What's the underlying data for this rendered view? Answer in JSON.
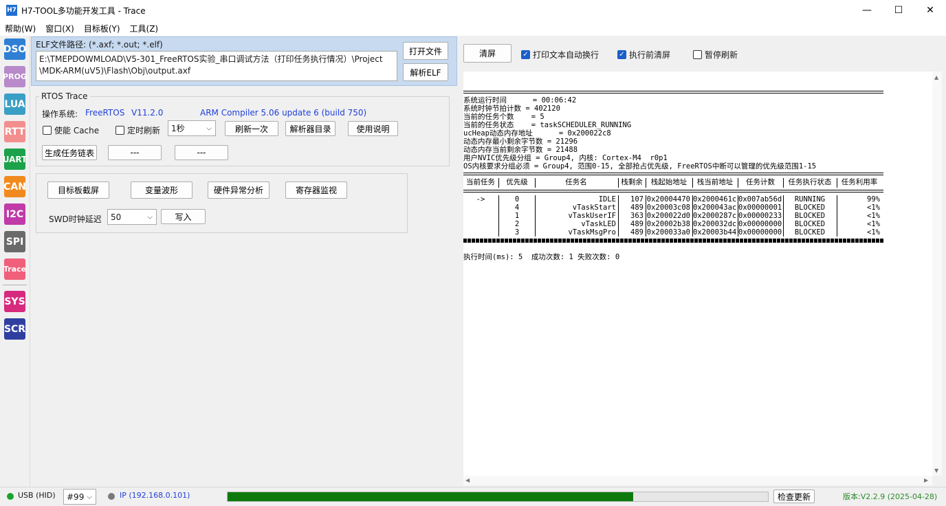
{
  "window": {
    "icon_text": "H7",
    "title": "H7-TOOL多功能开发工具 - Trace",
    "minimize": "—",
    "maximize": "☐",
    "close": "✕"
  },
  "menu": [
    "帮助(W)",
    "窗口(X)",
    "目标板(Y)",
    "工具(Z)"
  ],
  "sidebar": [
    {
      "label": "DSO",
      "color": "#2f7fd4"
    },
    {
      "label": "PROG",
      "color": "#b88ac9"
    },
    {
      "label": "LUA",
      "color": "#3a9fc5"
    },
    {
      "label": "RTT",
      "color": "#f28e8e"
    },
    {
      "label": "UART",
      "color": "#1ba24a"
    },
    {
      "label": "CAN",
      "color": "#f08a1e"
    },
    {
      "label": "I2C",
      "color": "#c03aa8"
    },
    {
      "label": "SPI",
      "color": "#6a6a6a"
    },
    {
      "label": "Trace",
      "color": "#f0607a"
    },
    {
      "label": "SYS",
      "color": "#d62a7e"
    },
    {
      "label": "SCR",
      "color": "#2f3fa0"
    }
  ],
  "elf": {
    "label": "ELF文件路径:  (*.axf; *.out; *.elf)",
    "path_line1": "E:\\TMEPDOWMLOAD\\V5-301_FreeRTOS实验_串口调试方法（打印任务执行情况）\\Project",
    "path_line2": "\\MDK-ARM(uV5)\\Flash\\Obj\\output.axf",
    "open_button": "打开文件",
    "parse_button": "解析ELF"
  },
  "rtos": {
    "group_title": "RTOS Trace",
    "os_label": "操作系统:",
    "os_name": "FreeRTOS",
    "os_version": "V11.2.0",
    "compiler": "ARM Compiler 5.06 update 6 (build 750)",
    "enable_cache": "使能 Cache",
    "timed_refresh": "定时刷新",
    "interval": "1秒",
    "refresh_once": "刷新一次",
    "parser_dir": "解析器目录",
    "usage": "使用说明",
    "gen_task_list": "生成任务链表",
    "btn_blank1": "---",
    "btn_blank2": "---"
  },
  "tools": {
    "screenshot": "目标板截屏",
    "var_wave": "变量波形",
    "hard_fault": "硬件异常分析",
    "reg_monitor": "寄存器监视",
    "swd_label": "SWD时钟延迟",
    "swd_value": "50",
    "write": "写入"
  },
  "right": {
    "clear": "清屏",
    "auto_wrap": "打印文本自动换行",
    "clear_before": "执行前清屏",
    "pause_refresh": "暂停刷新"
  },
  "console": {
    "info": [
      "系统运行时间      = 00:06:42",
      "系统时钟节拍计数 = 402120",
      "当前的任务个数    = 5",
      "当前的任务状态    = taskSCHEDULER_RUNNING",
      "ucHeap动态内存地址      = 0x200022c8",
      "动态内存最小剩余字节数 = 21296",
      "动态内存当前剩余字节数 = 21488",
      "用户NVIC优先级分组 = Group4, 内核: Cortex-M4  r0p1",
      "OS内核要求分组必须 = Group4, 范围0-15, 全部抢占优先级, FreeRTOS中断可以管理的优先级范围1-15"
    ],
    "headers": [
      "当前任务",
      "优先级",
      "任务名",
      "栈剩余",
      "栈起始地址",
      "栈当前地址",
      "任务计数",
      "任务执行状态",
      "任务利用率"
    ],
    "rows": [
      [
        "->",
        "0",
        "IDLE",
        "107",
        "0x20004470",
        "0x2000461c",
        "0x007ab56d",
        "RUNNING",
        "99%"
      ],
      [
        "",
        "4",
        "vTaskStart",
        "489",
        "0x20003c08",
        "0x200043ac",
        "0x00000001",
        "BLOCKED",
        "<1%"
      ],
      [
        "",
        "1",
        "vTaskUserIF",
        "363",
        "0x200022d0",
        "0x2000287c",
        "0x00000233",
        "BLOCKED",
        "<1%"
      ],
      [
        "",
        "2",
        "vTaskLED",
        "489",
        "0x20002b38",
        "0x200032dc",
        "0x00000000",
        "BLOCKED",
        "<1%"
      ],
      [
        "",
        "3",
        "vTaskMsgPro",
        "489",
        "0x200033a0",
        "0x20003b44",
        "0x00000000",
        "BLOCKED",
        "<1%"
      ]
    ],
    "footer": "执行时间(ms): 5  成功次数: 1 失败次数: 0"
  },
  "status": {
    "usb": "USB (HID)",
    "device": "#99",
    "ip": "IP (192.168.0.101)",
    "progress": 0.75,
    "check_update": "检查更新",
    "version": "版本:V2.2.9 (2025-04-28)",
    "usb_color": "#1aa52a",
    "ip_color": "#7a7a7a"
  }
}
